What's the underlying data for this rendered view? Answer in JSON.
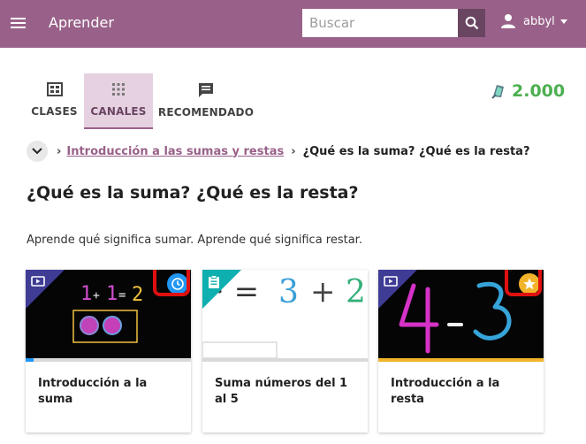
{
  "app": {
    "title": "Aprender"
  },
  "search": {
    "placeholder": "Buscar"
  },
  "user": {
    "name": "abbyl"
  },
  "tabs": [
    {
      "label": "CLASES",
      "icon": "classes-icon"
    },
    {
      "label": "CANALES",
      "icon": "channels-grid-icon",
      "active": true
    },
    {
      "label": "RECOMENDADO",
      "icon": "recommended-chat-icon"
    }
  ],
  "points": {
    "value": "2.000",
    "color": "#4caf50"
  },
  "breadcrumb": {
    "parent": "Introducción a las sumas y restas",
    "current": "¿Qué es la suma? ¿Qué es la resta?"
  },
  "topic": {
    "title": "¿Qué es la suma? ¿Qué es la resta?",
    "description": "Aprende qué significa sumar. Aprende qué significa restar."
  },
  "cards": [
    {
      "title": "Introducción a la suma",
      "kind": "video-icon",
      "status": "in-progress-clock-icon",
      "progress": 0.05,
      "thumb_text": "1 + 1 = 2"
    },
    {
      "title": "Suma números del 1 al 5",
      "kind": "exercise-icon",
      "status": "none",
      "progress": 0,
      "thumb_text": "= 3 + 2"
    },
    {
      "title": "Introducción a la resta",
      "kind": "video-icon",
      "status": "completed-star-icon",
      "progress": 1,
      "thumb_text": "4 - 3"
    }
  ],
  "colors": {
    "brand": "#996189",
    "brand_dark": "#6a4562",
    "video_corner": "#3f3c96",
    "exercise_corner": "#0eafaf",
    "in_progress": "#2196f3",
    "completed": "#f2b32a",
    "highlight": "#e01010"
  }
}
